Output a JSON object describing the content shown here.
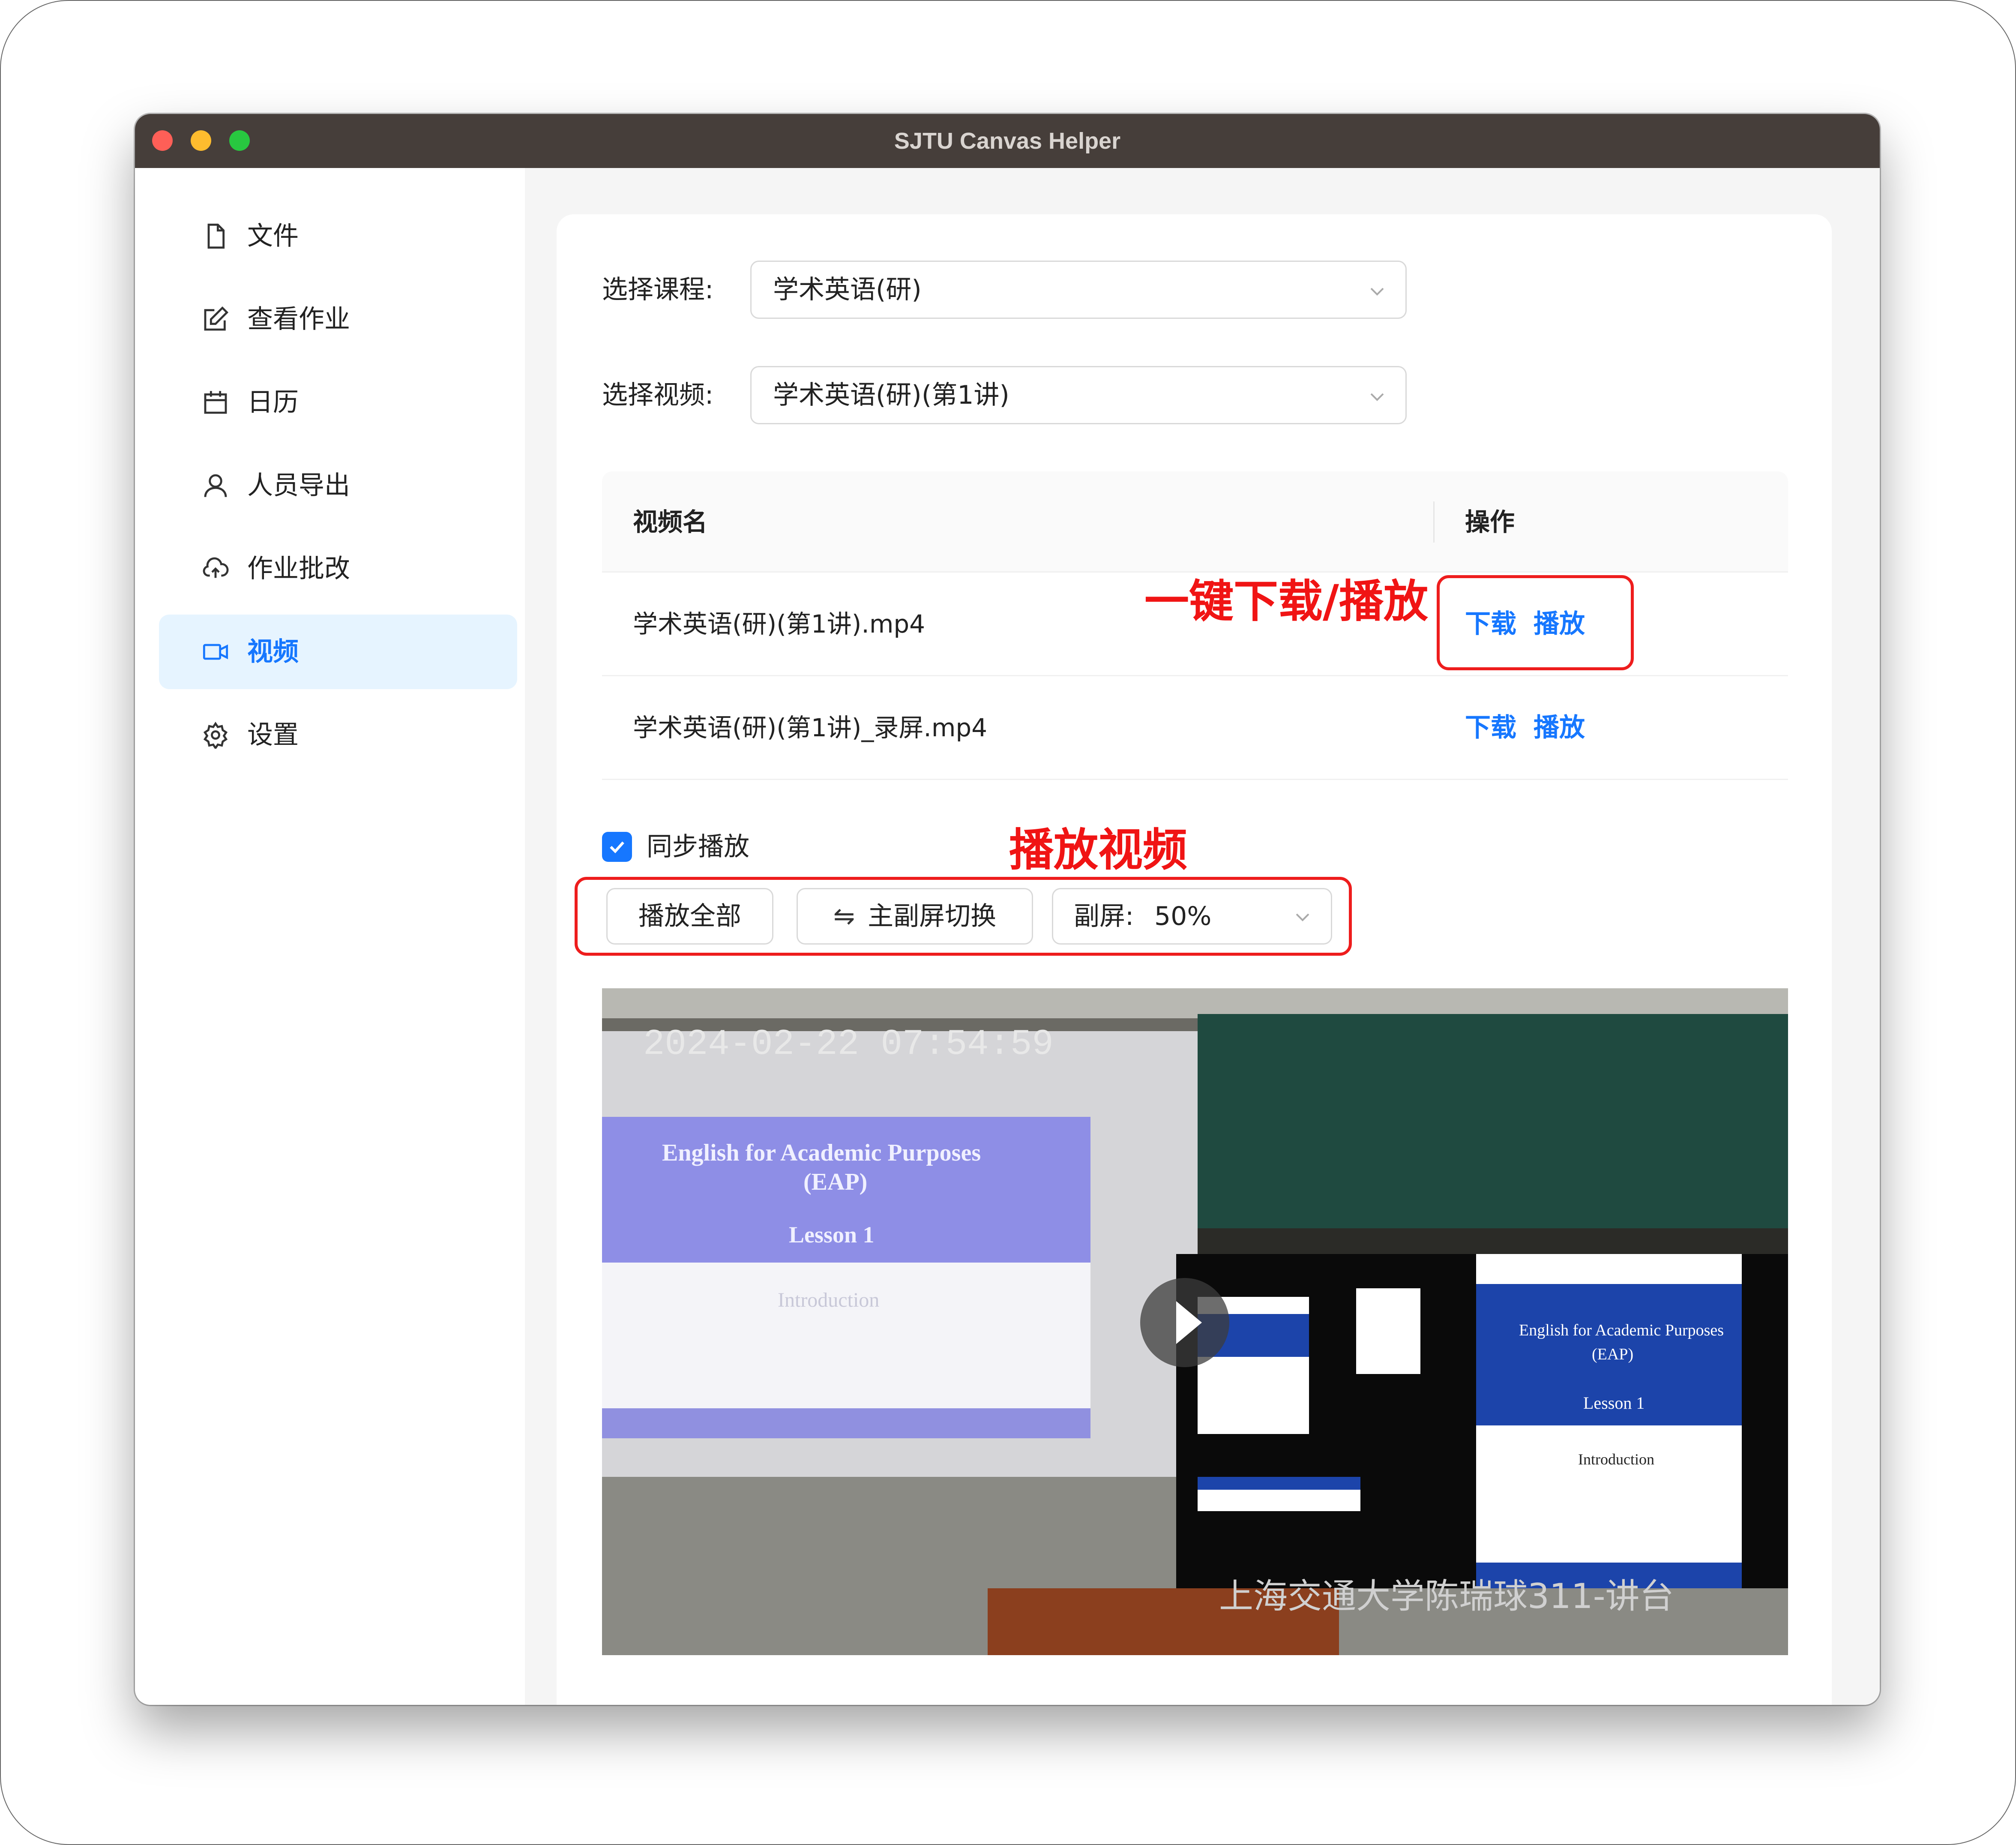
{
  "window": {
    "title": "SJTU Canvas Helper"
  },
  "sidebar": {
    "items": [
      {
        "label": "文件",
        "icon": "file-icon"
      },
      {
        "label": "查看作业",
        "icon": "edit-icon"
      },
      {
        "label": "日历",
        "icon": "calendar-icon"
      },
      {
        "label": "人员导出",
        "icon": "user-icon"
      },
      {
        "label": "作业批改",
        "icon": "cloud-upload-icon"
      },
      {
        "label": "视频",
        "icon": "video-icon",
        "active": true
      },
      {
        "label": "设置",
        "icon": "gear-icon"
      }
    ]
  },
  "form": {
    "course_label": "选择课程:",
    "course_value": "学术英语(研)",
    "video_label": "选择视频:",
    "video_value": "学术英语(研)(第1讲)"
  },
  "table": {
    "columns": [
      "视频名",
      "操作"
    ],
    "rows": [
      {
        "name": "学术英语(研)(第1讲).mp4",
        "download": "下载",
        "play": "播放"
      },
      {
        "name": "学术英语(研)(第1讲)_录屏.mp4",
        "download": "下载",
        "play": "播放"
      }
    ]
  },
  "controls": {
    "sync_label": "同步播放",
    "sync_checked": true,
    "play_all": "播放全部",
    "switch_screen": "主副屏切换",
    "sub_screen_label": "副屏:",
    "sub_screen_value": "50%"
  },
  "annotations": {
    "one_click": "一键下载/播放",
    "play_video": "播放视频"
  },
  "video": {
    "timestamp": "2024-02-22 07:54:59",
    "slide_title": "English for Academic Purposes",
    "slide_subtitle": "(EAP)",
    "slide_lesson": "Lesson 1",
    "slide_intro": "Introduction",
    "pip_title": "English for Academic Purposes",
    "pip_subtitle": "(EAP)",
    "pip_lesson": "Lesson 1",
    "pip_intro": "Introduction",
    "watermark": "上海交通大学陈瑞球311-讲台"
  },
  "colors": {
    "accent": "#1677ff",
    "annotation": "#f01414",
    "titlebar": "#463e3a"
  }
}
